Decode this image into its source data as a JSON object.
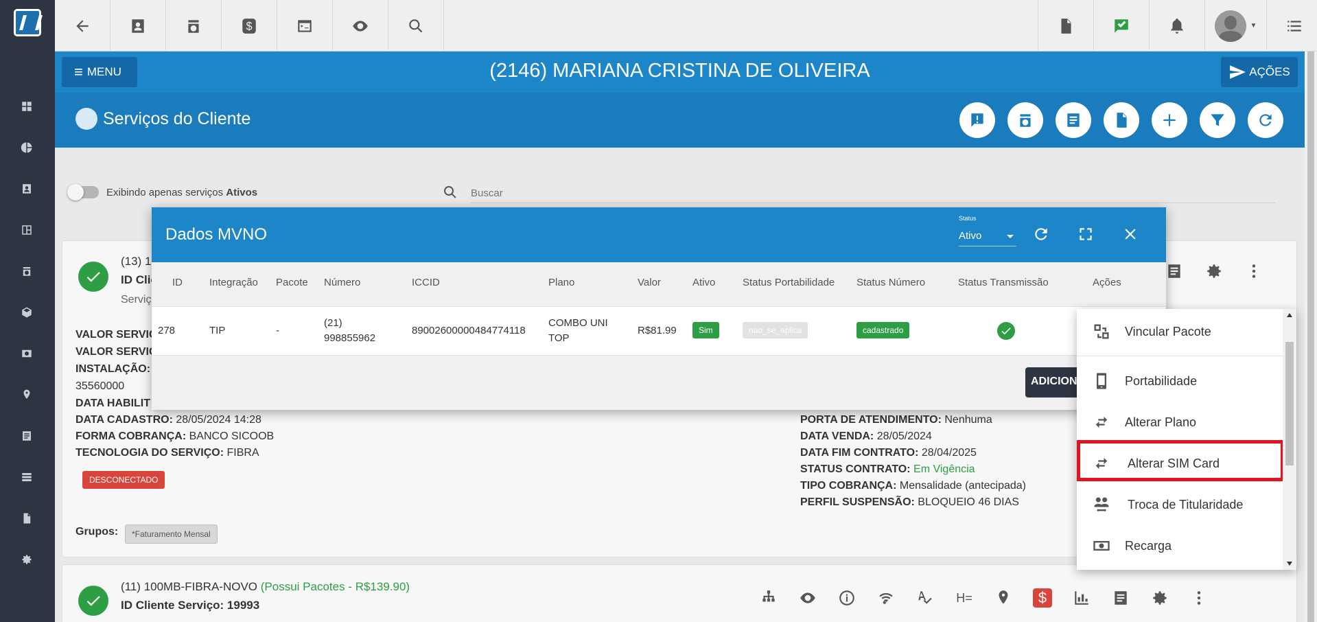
{
  "topbar": {
    "icons": [
      "back-arrow-icon",
      "contact-card-icon",
      "calendar-clock-icon",
      "dollar-icon",
      "terminal-icon",
      "eye-icon",
      "search-icon",
      "pdf-icon",
      "chat-check-icon",
      "bell-icon",
      "avatar",
      "list-icon"
    ]
  },
  "customer": {
    "menu_label": "MENU",
    "title": "(2146) MARIANA CRISTINA DE OLIVEIRA",
    "acoes_label": "AÇÕES"
  },
  "services_header": {
    "title": "Serviços do Cliente"
  },
  "filter": {
    "toggle_label_prefix": "Exibindo apenas serviços ",
    "toggle_label_bold": "Ativos",
    "search_placeholder": "Buscar"
  },
  "card1": {
    "title_partial": "(13) 1",
    "id_partial": "ID Clie",
    "serv_partial": "Serviç",
    "left_labels": [
      "VALOR SERVIC",
      "VALOR SERVIC",
      "INSTALAÇÃO:"
    ],
    "zip": "35560000",
    "data_habilit": "DATA HABILIT",
    "data_cadastro_label": "DATA CADASTRO:",
    "data_cadastro_value": "28/05/2024 14:28",
    "forma_label": "FORMA COBRANÇA:",
    "forma_value": "BANCO SICOOB",
    "tecnologia_label": "TECNOLOGIA DO SERVIÇO:",
    "tecnologia_value": "FIBRA",
    "status_badge": "DESCONECTADO",
    "grupos_label": "Grupos:",
    "grupo_chip": "*Faturamento Mensal",
    "right": {
      "porta_label": "PORTA DE ATENDIMENTO:",
      "porta_value": "Nenhuma",
      "venda_label": "DATA VENDA:",
      "venda_value": "28/05/2024",
      "fim_label": "DATA FIM CONTRATO:",
      "fim_value": "28/04/2025",
      "status_label": "STATUS CONTRATO:",
      "status_value": "Em Vigência",
      "tipo_label": "TIPO COBRANÇA:",
      "tipo_value": "Mensalidade (antecipada)",
      "perfil_label": "PERFIL SUSPENSÃO:",
      "perfil_value": "BLOQUEIO 46 DIAS"
    }
  },
  "card2": {
    "title": "(11) 100MB-FIBRA-NOVO",
    "title_green": "(Possui Pacotes - R$139.90)",
    "id_line": "ID Cliente Serviço: 19993"
  },
  "modal": {
    "title": "Dados MVNO",
    "status_label": "Status",
    "status_value": "Ativo",
    "columns": [
      "ID",
      "Integração",
      "Pacote",
      "Número",
      "ICCID",
      "Plano",
      "Valor",
      "Ativo",
      "Status Portabilidade",
      "Status Número",
      "Status Transmissão",
      "Ações"
    ],
    "row": {
      "id": "278",
      "integracao": "TIP",
      "pacote": "-",
      "numero_1": "(21)",
      "numero_2": "998855962",
      "iccid": "89002600000484774118",
      "plano_1": "COMBO UNI",
      "plano_2": "TOP",
      "valor": "R$81.99",
      "ativo": "Sim",
      "portabilidade": "nao_se_aplica",
      "status_numero": "cadastrado"
    },
    "add_button": "ADICIONAR"
  },
  "dropdown": {
    "items": [
      {
        "label": "Vincular Pacote",
        "icon": "link-blocks-icon"
      },
      {
        "label": "Portabilidade",
        "icon": "phone-icon"
      },
      {
        "label": "Alterar Plano",
        "icon": "swap-icon"
      },
      {
        "label": "Alterar SIM Card",
        "icon": "swap-icon"
      },
      {
        "label": "Troca de Titularidade",
        "icon": "people-swap-icon"
      },
      {
        "label": "Recarga",
        "icon": "cash-icon"
      }
    ],
    "highlighted_index": 3,
    "highlight_color": "#e3141f"
  },
  "colors": {
    "primary": "#1d86c8",
    "dark": "#2c3541",
    "success": "#2e9e44",
    "danger": "#d9453c"
  }
}
